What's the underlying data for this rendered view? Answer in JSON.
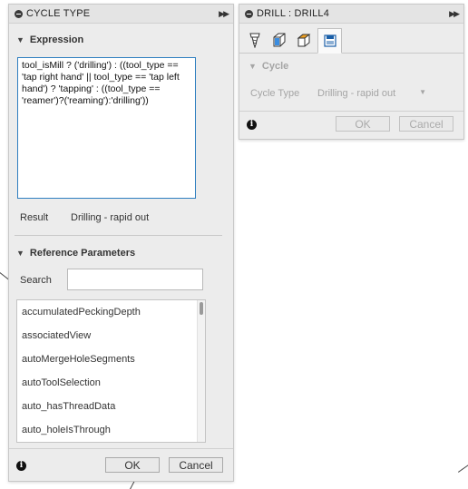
{
  "cycle_panel": {
    "title": "CYCLE TYPE",
    "expression_section": {
      "label": "Expression",
      "text": "tool_isMill ? ('drilling') : ((tool_type == 'tap right hand' || tool_type == 'tap left hand') ? 'tapping' : ((tool_type == 'reamer')?('reaming'):'drilling'))"
    },
    "result": {
      "label": "Result",
      "value": "Drilling - rapid out"
    },
    "reference_section": {
      "label": "Reference Parameters",
      "search_label": "Search",
      "search_value": "",
      "items": [
        "accumulatedPeckingDepth",
        "associatedView",
        "autoMergeHoleSegments",
        "autoToolSelection",
        "auto_hasThreadData",
        "auto_holeIsThrough"
      ]
    },
    "footer": {
      "ok_label": "OK",
      "cancel_label": "Cancel"
    }
  },
  "drill_panel": {
    "title": "DRILL : DRILL4",
    "tabs": [
      {
        "icon": "tool-tab-icon"
      },
      {
        "icon": "geometry-tab-icon"
      },
      {
        "icon": "heights-tab-icon"
      },
      {
        "icon": "cycle-tab-icon",
        "active": true
      }
    ],
    "cycle_section": {
      "label": "Cycle",
      "cycle_type_label": "Cycle Type",
      "cycle_type_value": "Drilling - rapid out"
    },
    "footer": {
      "ok_label": "OK",
      "cancel_label": "Cancel"
    }
  },
  "colors": {
    "accent": "#2f7fc0",
    "panel_bg": "#ececec"
  }
}
